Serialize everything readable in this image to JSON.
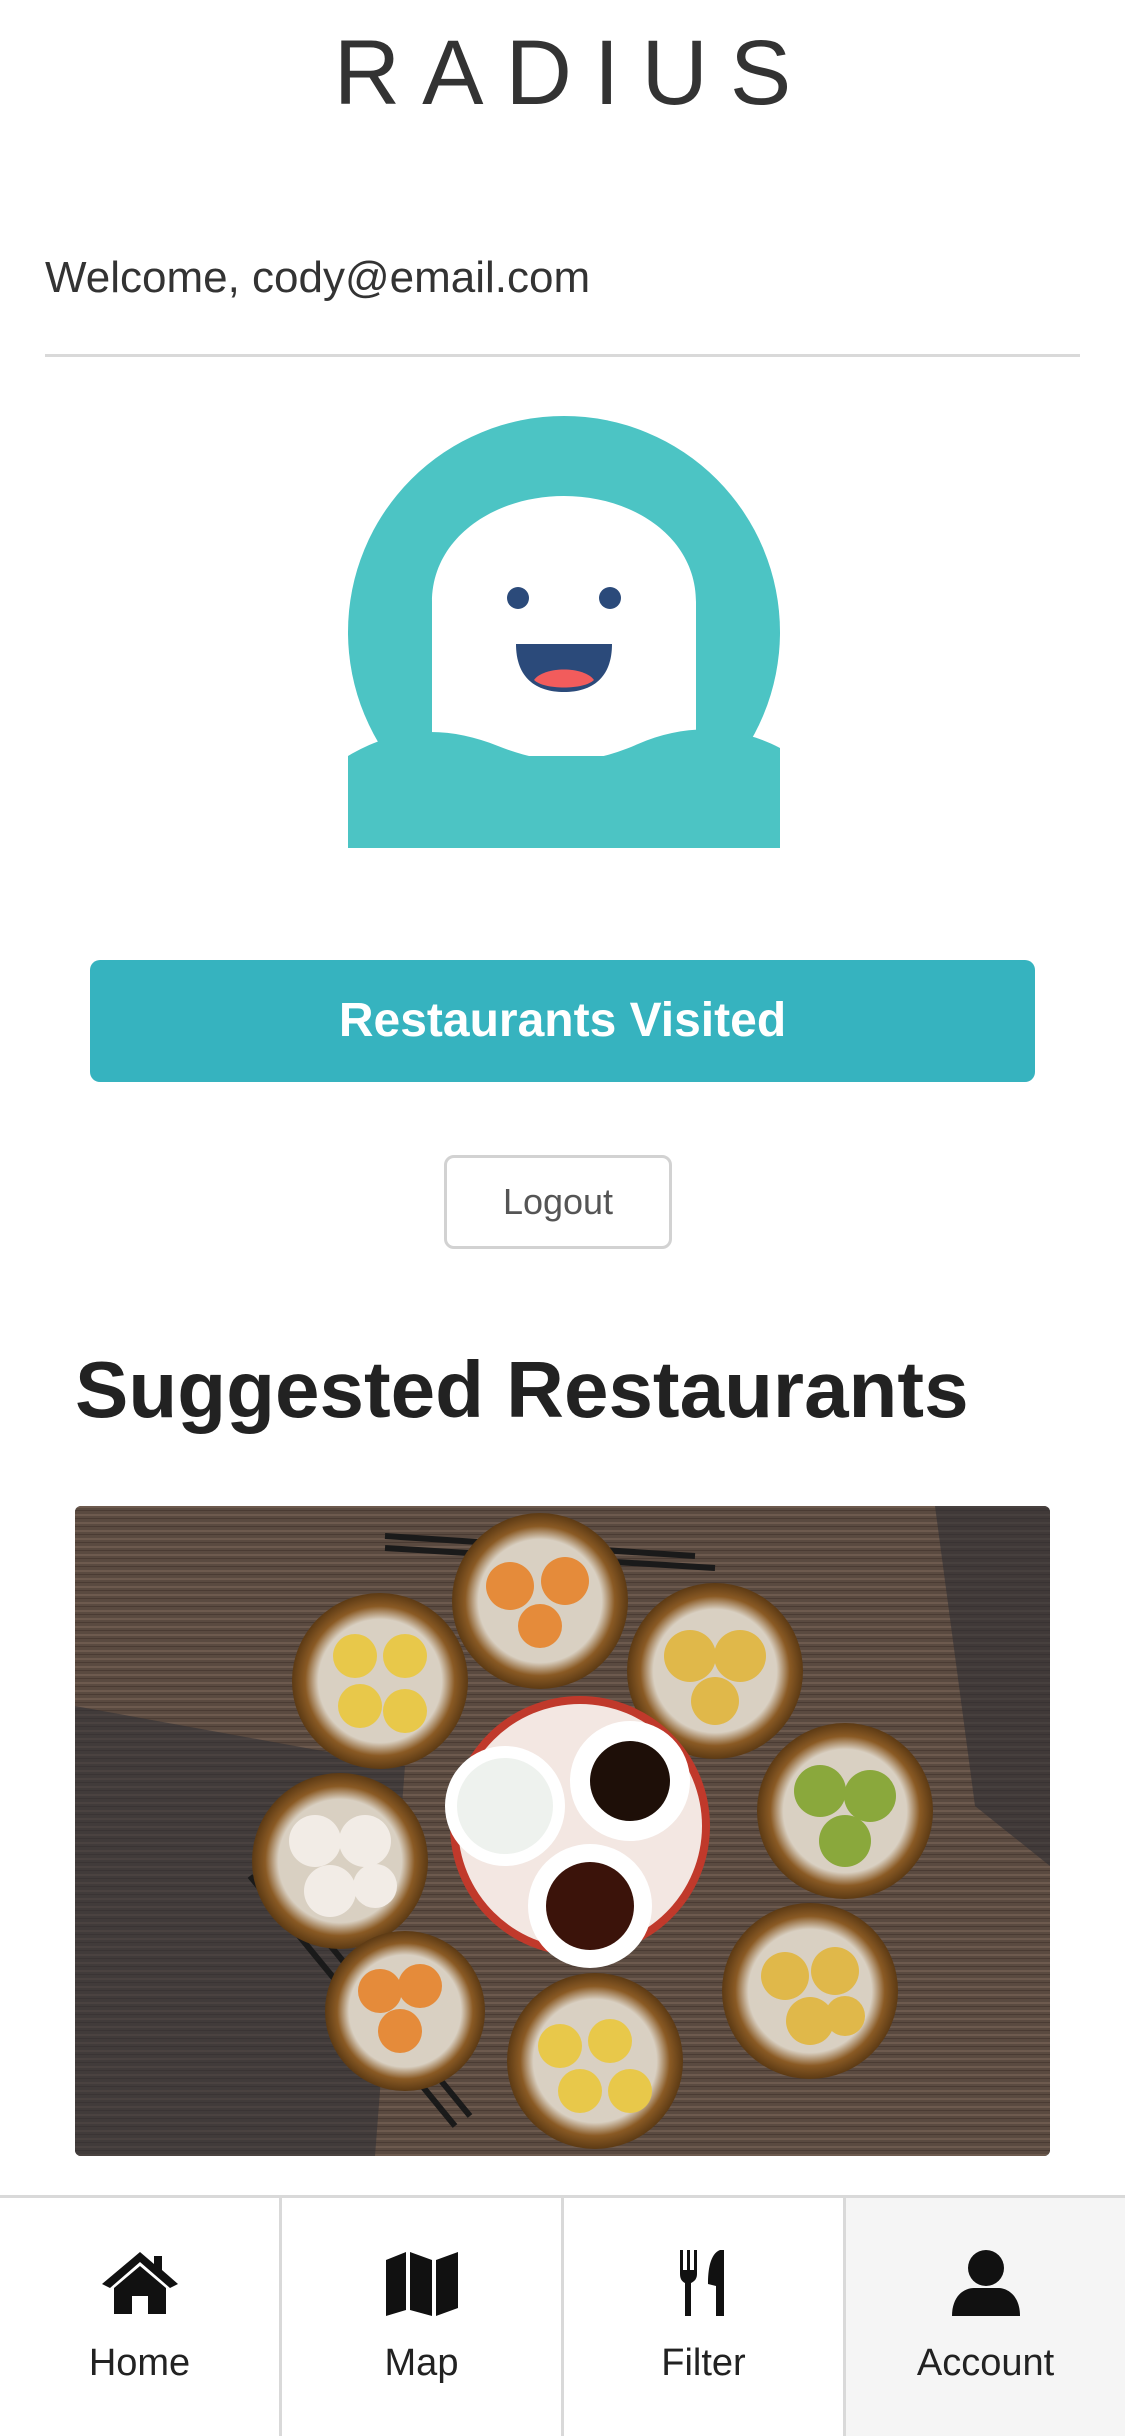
{
  "header": {
    "app_title": "RADIUS"
  },
  "account": {
    "welcome_text": "Welcome, cody@email.com",
    "avatar_icon": "ghost-avatar-icon"
  },
  "actions": {
    "restaurants_visited_label": "Restaurants Visited",
    "logout_label": "Logout"
  },
  "suggested": {
    "heading": "Suggested Restaurants",
    "cards": [
      {
        "image": "dim-sum-photo"
      }
    ]
  },
  "tabbar": {
    "tabs": [
      {
        "label": "Home",
        "icon": "home-icon",
        "active": false
      },
      {
        "label": "Map",
        "icon": "map-icon",
        "active": false
      },
      {
        "label": "Filter",
        "icon": "utensils-icon",
        "active": false
      },
      {
        "label": "Account",
        "icon": "user-icon",
        "active": true
      }
    ]
  },
  "colors": {
    "accent": "#36b3bf",
    "avatar_bg": "#4cc4c4",
    "active_tab_bg": "#f5f5f5"
  }
}
